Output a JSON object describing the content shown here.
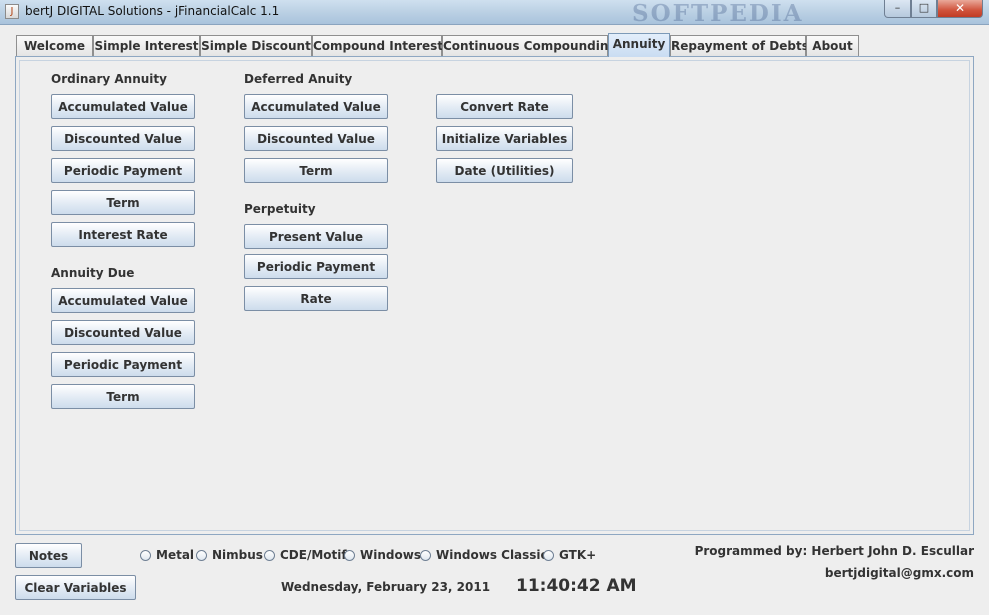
{
  "window": {
    "title": "bertJ DIGITAL Solutions - jFinancialCalc 1.1",
    "watermark": "SOFTPEDIA",
    "min_glyph": "–",
    "max_glyph": "□",
    "close_glyph": "✕",
    "app_icon_glyph": "J"
  },
  "tabs": [
    {
      "label": "Welcome"
    },
    {
      "label": "Simple Interest"
    },
    {
      "label": "Simple Discount"
    },
    {
      "label": "Compound Interest"
    },
    {
      "label": "Continuous Compounding"
    },
    {
      "label": "Annuity",
      "active": true
    },
    {
      "label": "Repayment of Debts"
    },
    {
      "label": "About"
    }
  ],
  "ordinary_annuity": {
    "heading": "Ordinary Annuity",
    "buttons": [
      "Accumulated Value",
      "Discounted Value",
      "Periodic Payment",
      "Term",
      "Interest Rate"
    ]
  },
  "annuity_due": {
    "heading": "Annuity Due",
    "buttons": [
      "Accumulated Value",
      "Discounted Value",
      "Periodic Payment",
      "Term"
    ]
  },
  "deferred_annuity": {
    "heading": "Deferred Anuity",
    "buttons": [
      "Accumulated Value",
      "Discounted Value",
      "Term"
    ]
  },
  "perpetuity": {
    "heading": "Perpetuity",
    "buttons": [
      "Present Value",
      "Periodic Payment",
      "Rate"
    ]
  },
  "utilities": {
    "buttons": [
      "Convert Rate",
      "Initialize Variables",
      "Date (Utilities)"
    ]
  },
  "footer": {
    "notes_label": "Notes",
    "clear_label": "Clear Variables",
    "look_and_feel": [
      "Metal",
      "Nimbus",
      "CDE/Motif",
      "Windows",
      "Windows Classic",
      "GTK+"
    ],
    "date": "Wednesday, February 23, 2011",
    "time": "11:40:42 AM",
    "programmed_by": "Programmed by: Herbert John D. Escullar",
    "email": "bertjdigital@gmx.com"
  }
}
